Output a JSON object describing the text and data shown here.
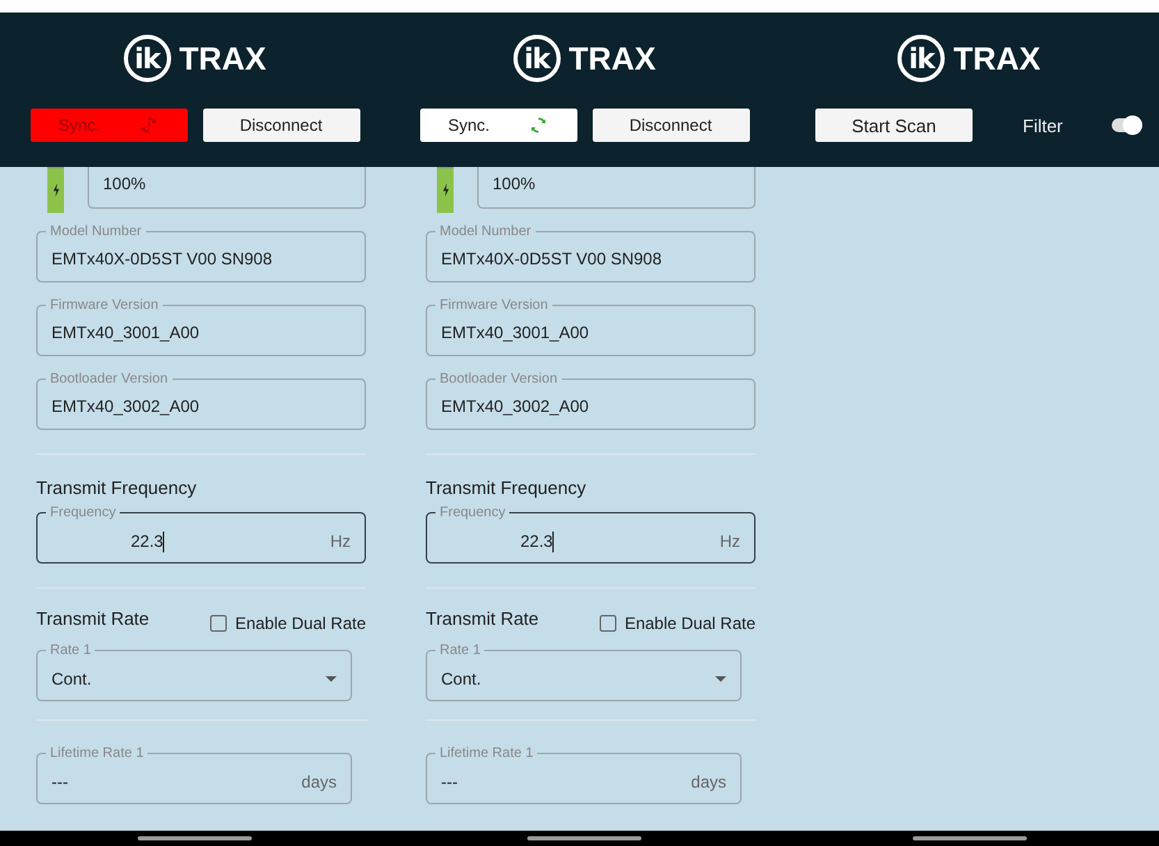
{
  "panels": [
    {
      "kind": "device",
      "logo": {
        "mark": "ik",
        "name": "TRAX"
      },
      "sync": {
        "label": "Sync.",
        "error": true
      },
      "disconnect": "Disconnect",
      "battery": {
        "level": 0.85,
        "value": "100%"
      },
      "fields": [
        {
          "label": "Model Number",
          "value": "EMTx40X-0D5ST V00 SN908"
        },
        {
          "label": "Firmware Version",
          "value": "EMTx40_3001_A00"
        },
        {
          "label": "Bootloader Version",
          "value": "EMTx40_3002_A00"
        }
      ],
      "frequency": {
        "title": "Transmit Frequency",
        "label": "Frequency",
        "value": "22.3",
        "unit": "Hz"
      },
      "rate": {
        "title": "Transmit Rate",
        "dual_rate": {
          "label": "Enable Dual Rate",
          "checked": false
        },
        "select_label": "Rate 1",
        "select_value": "Cont.",
        "lifetime_label": "Lifetime Rate 1",
        "lifetime_value": "---",
        "lifetime_unit": "days"
      }
    },
    {
      "kind": "device",
      "logo": {
        "mark": "ik",
        "name": "TRAX"
      },
      "sync": {
        "label": "Sync.",
        "error": false
      },
      "disconnect": "Disconnect",
      "battery": {
        "level": 0.85,
        "value": "100%"
      },
      "fields": [
        {
          "label": "Model Number",
          "value": "EMTx40X-0D5ST V00 SN908"
        },
        {
          "label": "Firmware Version",
          "value": "EMTx40_3001_A00"
        },
        {
          "label": "Bootloader Version",
          "value": "EMTx40_3002_A00"
        }
      ],
      "frequency": {
        "title": "Transmit Frequency",
        "label": "Frequency",
        "value": "22.3",
        "unit": "Hz"
      },
      "rate": {
        "title": "Transmit Rate",
        "dual_rate": {
          "label": "Enable Dual Rate",
          "checked": false
        },
        "select_label": "Rate 1",
        "select_value": "Cont.",
        "lifetime_label": "Lifetime Rate 1",
        "lifetime_value": "---",
        "lifetime_unit": "days"
      }
    },
    {
      "kind": "scan",
      "logo": {
        "mark": "ik",
        "name": "TRAX"
      },
      "scan_button": "Start Scan",
      "filter": {
        "label": "Filter",
        "on": true
      }
    }
  ]
}
